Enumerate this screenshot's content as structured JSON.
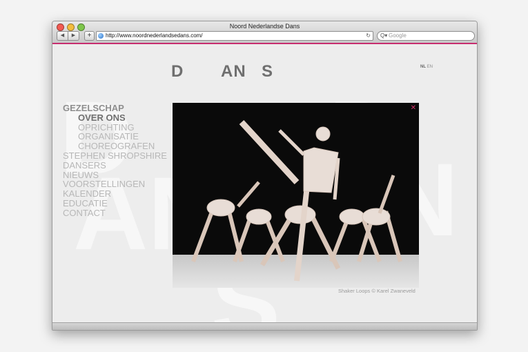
{
  "window": {
    "title": "Noord Nederlandse Dans"
  },
  "toolbar": {
    "back_label": "◀",
    "forward_label": "▶",
    "add_label": "+",
    "url": "http://www.noordnederlandsedans.com/",
    "reload_label": "↻",
    "search_placeholder": "Google",
    "search_icon_label": "Q▾"
  },
  "site": {
    "logo_letters": [
      "D",
      "AN",
      "S"
    ],
    "background_letters": [
      "D",
      "AN",
      "S",
      "D",
      "N"
    ],
    "lang": {
      "nl": "NL",
      "en": "EN"
    },
    "menu": [
      {
        "label": "GEZELSCHAP",
        "level": 0,
        "state": "head"
      },
      {
        "label": "OVER ONS",
        "level": 1,
        "state": "active"
      },
      {
        "label": "OPRICHTING",
        "level": 1,
        "state": "normal"
      },
      {
        "label": "ORGANISATIE",
        "level": 1,
        "state": "normal"
      },
      {
        "label": "CHOREOGRAFEN",
        "level": 1,
        "state": "normal"
      },
      {
        "label": "STEPHEN SHROPSHIRE",
        "level": 0,
        "state": "normal"
      },
      {
        "label": "DANSERS",
        "level": 0,
        "state": "normal"
      },
      {
        "label": "NIEUWS",
        "level": 0,
        "state": "normal"
      },
      {
        "label": "VOORSTELLINGEN",
        "level": 0,
        "state": "normal"
      },
      {
        "label": "KALENDER",
        "level": 0,
        "state": "normal"
      },
      {
        "label": "EDUCATIE",
        "level": 0,
        "state": "normal"
      },
      {
        "label": "CONTACT",
        "level": 0,
        "state": "normal"
      }
    ],
    "photo_close": "✕",
    "caption": "Shaker Loops © Karel Zwaneveld"
  },
  "colors": {
    "accent": "#c72d6f",
    "logo": "#6f6f6f",
    "menu": "#b7b7b7"
  }
}
